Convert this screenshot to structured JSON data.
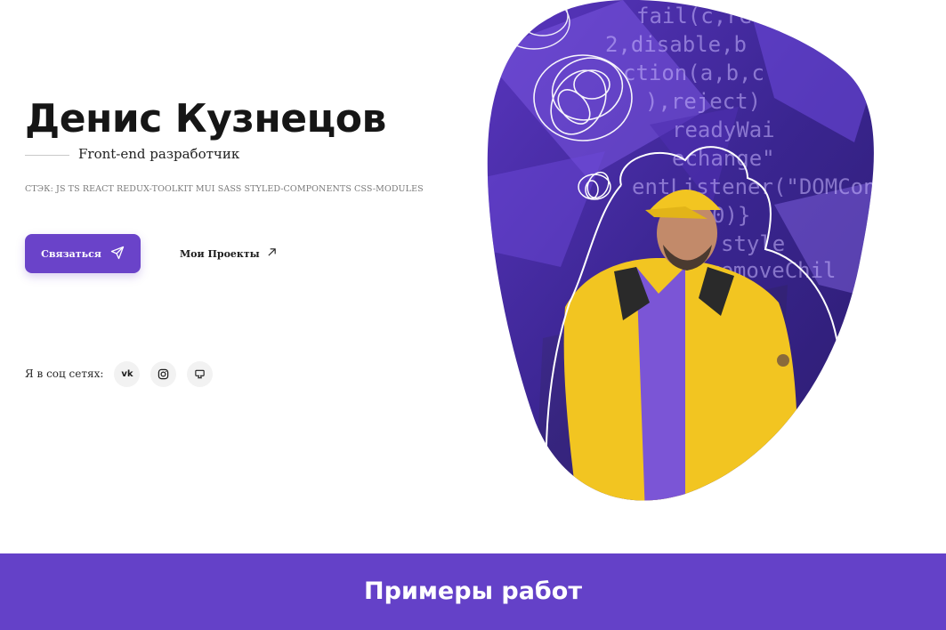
{
  "hero": {
    "name": "Денис Кузнецов",
    "role": "Front-end разработчик",
    "stack": "СТЭК: JS TS REACT REDUX-TOOLKIT MUI SASS STYLED-COMPONENTS CSS-MODULES",
    "contact_label": "Связаться",
    "projects_label": "Мои Проекты",
    "social_label": "Я в соц сетях:",
    "social": [
      {
        "name": "vk",
        "icon": "vk-icon",
        "glyph": "vk"
      },
      {
        "name": "instagram",
        "icon": "instagram-icon"
      },
      {
        "name": "github",
        "icon": "github-icon"
      }
    ],
    "photo_code_lines": [
      "fail(c,re",
      "2,disable,b",
      "ction(a,b,c",
      "),reject)",
      "readyWai",
      "echange\"",
      "entListener(\"DOMCont",
      "0)}",
      "style",
      "removeChil"
    ]
  },
  "works": {
    "title": "Примеры работ"
  },
  "colors": {
    "accent": "#6a43c9",
    "band": "#6441c8",
    "jacket": "#f2c521",
    "photo_bg": "#3a2a8c"
  }
}
